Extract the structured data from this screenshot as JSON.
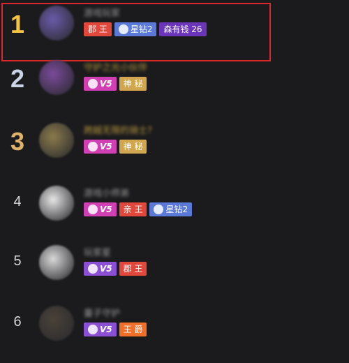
{
  "colors": {
    "gold": "#f5c542",
    "silver": "#c9d3e6",
    "bronze": "#e0b26a",
    "highlight_border": "#e0262a",
    "background": "#1b1b1d"
  },
  "leaderboard": [
    {
      "rank": "1",
      "rank_style": "gold",
      "name": "游戏玩家",
      "name_color": "#9a9a9a",
      "avatar_color": "#6a5aa8",
      "highlighted": true,
      "badges": [
        {
          "text": "郡 王",
          "icon": "",
          "bg": "#e2473b"
        },
        {
          "text": "星钻2",
          "icon": "star-diamond-icon",
          "bg": "#5b79d9"
        },
        {
          "text": "森有钱 26",
          "icon": "",
          "bg": "#6a35b8"
        }
      ]
    },
    {
      "rank": "2",
      "rank_style": "silver",
      "name": "守护之光小伙伴",
      "name_color": "#b5953a",
      "avatar_color": "#7a4a9a",
      "highlighted": false,
      "badges": [
        {
          "text": "V5",
          "icon": "vip-wings-icon",
          "bg": "#d23fb4"
        },
        {
          "text": "神 秘",
          "icon": "",
          "bg": "#d1a64e"
        }
      ]
    },
    {
      "rank": "3",
      "rank_style": "bronze",
      "name": "跨越无限的骑士?",
      "name_color": "#b5953a",
      "avatar_color": "#8a7a4a",
      "highlighted": false,
      "badges": [
        {
          "text": "V5",
          "icon": "vip-wings-icon",
          "bg": "#d23fb4"
        },
        {
          "text": "神 秘",
          "icon": "",
          "bg": "#d1a64e"
        }
      ]
    },
    {
      "rank": "4",
      "rank_style": "plain",
      "name": "游戏小师弟",
      "name_color": "#9a9a9a",
      "avatar_color": "#e6e6e6",
      "highlighted": false,
      "badges": [
        {
          "text": "V5",
          "icon": "vip-wings-icon",
          "bg": "#d23fb4"
        },
        {
          "text": "亲 王",
          "icon": "",
          "bg": "#e2473b"
        },
        {
          "text": "星钻2",
          "icon": "star-diamond-icon",
          "bg": "#5b79d9"
        }
      ]
    },
    {
      "rank": "5",
      "rank_style": "plain",
      "name": "玩家星",
      "name_color": "#9a9a9a",
      "avatar_color": "#d8d8d8",
      "highlighted": false,
      "badges": [
        {
          "text": "V5",
          "icon": "vip-wings-icon",
          "bg": "#8a4fd4"
        },
        {
          "text": "郡 王",
          "icon": "",
          "bg": "#e2473b"
        }
      ]
    },
    {
      "rank": "6",
      "rank_style": "plain",
      "name": "量子守护",
      "name_color": "#9a9a9a",
      "avatar_color": "#4a4238",
      "highlighted": false,
      "badges": [
        {
          "text": "V5",
          "icon": "vip-wings-icon",
          "bg": "#8a4fd4"
        },
        {
          "text": "王 爵",
          "icon": "",
          "bg": "#f0702a"
        }
      ]
    }
  ]
}
